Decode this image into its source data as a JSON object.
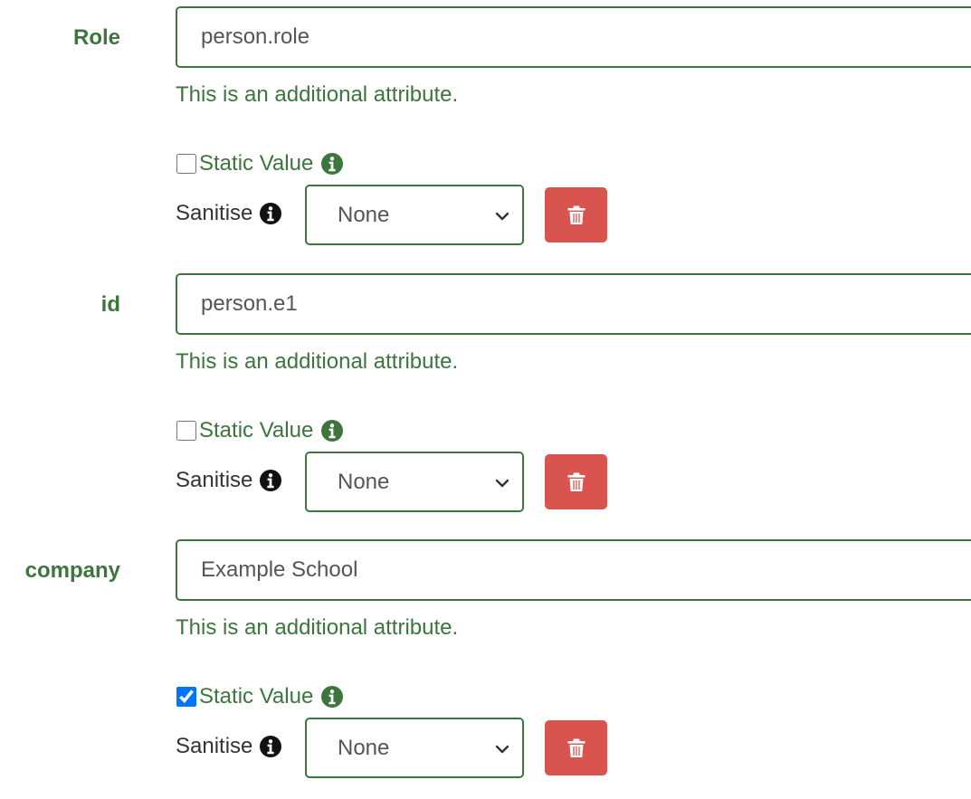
{
  "attributes": [
    {
      "label": "Role",
      "value": "person.role",
      "help": "This is an additional attribute.",
      "static_label": "Static Value",
      "static_checked": false,
      "sanitise_label": "Sanitise",
      "sanitise_selected": "None"
    },
    {
      "label": "id",
      "value": "person.e1",
      "help": "This is an additional attribute.",
      "static_label": "Static Value",
      "static_checked": false,
      "sanitise_label": "Sanitise",
      "sanitise_selected": "None"
    },
    {
      "label": "company",
      "value": "Example School",
      "help": "This is an additional attribute.",
      "static_label": "Static Value",
      "static_checked": true,
      "sanitise_label": "Sanitise",
      "sanitise_selected": "None"
    }
  ],
  "icons": {
    "static_info": "info-circle-icon",
    "sanitise_info": "info-circle-icon",
    "delete": "trash-icon",
    "select_arrow": "chevron-down-icon"
  },
  "colors": {
    "success_green": "#3c763d",
    "danger_red": "#d9534f",
    "text_dark": "#333333",
    "input_text": "#555555"
  }
}
